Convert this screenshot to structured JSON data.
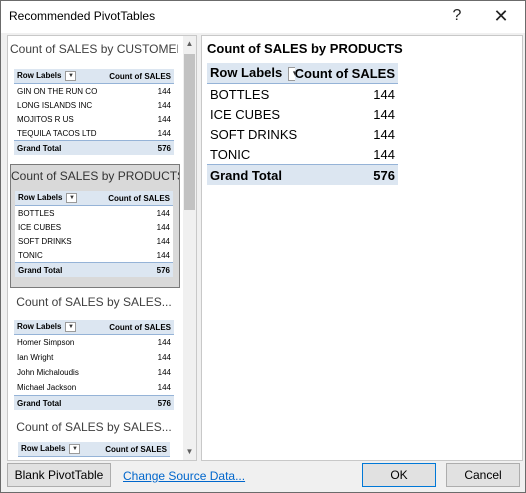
{
  "window": {
    "title": "Recommended PivotTables",
    "help_label": "?",
    "close_label": "✕"
  },
  "preview": {
    "title": "Count of SALES by PRODUCTS",
    "header": {
      "row_labels": "Row Labels",
      "count": "Count of SALES"
    },
    "rows": [
      {
        "label": "BOTTLES",
        "value": "144"
      },
      {
        "label": "ICE CUBES",
        "value": "144"
      },
      {
        "label": "SOFT DRINKS",
        "value": "144"
      },
      {
        "label": "TONIC",
        "value": "144"
      }
    ],
    "total": {
      "label": "Grand Total",
      "value": "576"
    }
  },
  "cards": [
    {
      "title": "Count of SALES by CUSTOMER",
      "header": {
        "row_labels": "Row Labels",
        "count": "Count of SALES"
      },
      "rows": [
        {
          "label": "GIN ON THE RUN CO",
          "value": "144"
        },
        {
          "label": "LONG ISLANDS INC",
          "value": "144"
        },
        {
          "label": "MOJITOS R US",
          "value": "144"
        },
        {
          "label": "TEQUILA TACOS LTD",
          "value": "144"
        }
      ],
      "total": {
        "label": "Grand Total",
        "value": "576"
      }
    },
    {
      "title": "Count of SALES by PRODUCTS",
      "header": {
        "row_labels": "Row Labels",
        "count": "Count of SALES"
      },
      "rows": [
        {
          "label": "BOTTLES",
          "value": "144"
        },
        {
          "label": "ICE CUBES",
          "value": "144"
        },
        {
          "label": "SOFT DRINKS",
          "value": "144"
        },
        {
          "label": "TONIC",
          "value": "144"
        }
      ],
      "total": {
        "label": "Grand Total",
        "value": "576"
      }
    },
    {
      "title": "Count of SALES by SALES...",
      "header": {
        "row_labels": "Row Labels",
        "count": "Count of SALES"
      },
      "rows": [
        {
          "label": "Homer Simpson",
          "value": "144"
        },
        {
          "label": "Ian Wright",
          "value": "144"
        },
        {
          "label": "John Michaloudis",
          "value": "144"
        },
        {
          "label": "Michael Jackson",
          "value": "144"
        }
      ],
      "total": {
        "label": "Grand Total",
        "value": "576"
      }
    },
    {
      "title": "Count of SALES by SALES...",
      "header": {
        "row_labels": "Row Labels",
        "count": "Count of SALES"
      }
    }
  ],
  "footer": {
    "blank_label": "Blank PivotTable",
    "change_source_label": "Change Source Data...",
    "ok_label": "OK",
    "cancel_label": "Cancel"
  },
  "icons": {
    "dropdown": "dropdown-arrow-icon",
    "scroll_up": "scroll-up-arrow-icon",
    "scroll_down": "scroll-down-arrow-icon"
  },
  "colors": {
    "pivot_header": "#dce6f1",
    "pivot_border": "#95b3d7",
    "selected_card": "#d9d9d9",
    "link": "#0066cc"
  }
}
